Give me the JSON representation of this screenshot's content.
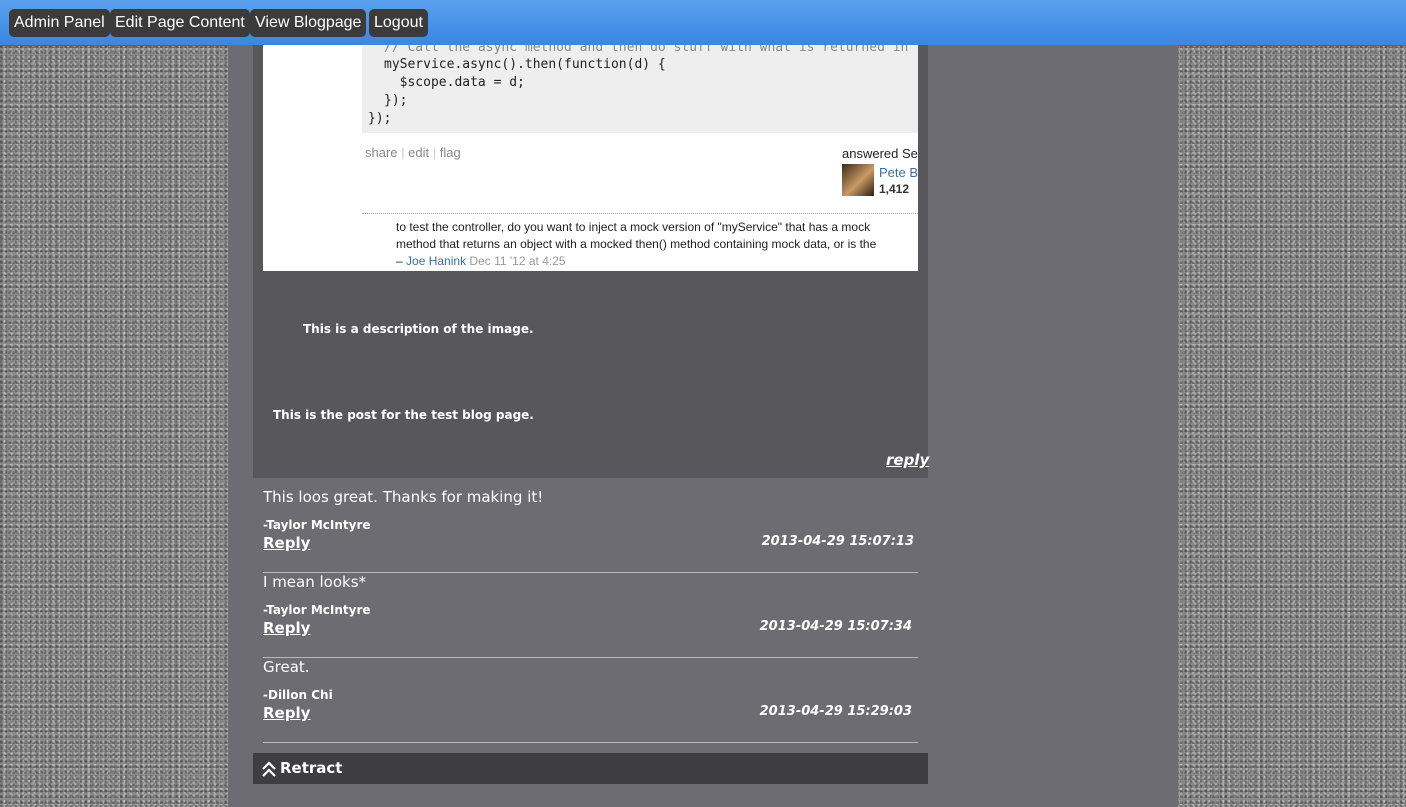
{
  "nav": {
    "admin_panel": "Admin Panel",
    "edit_page_content": "Edit Page Content",
    "view_blogpage": "View Blogpage",
    "logout": "Logout"
  },
  "post": {
    "image": {
      "code_lines": [
        "// Call the async method and then do stuff with what is returned in",
        "myService.async().then(function(d) {",
        "  $scope.data = d;",
        "});",
        "});"
      ],
      "actions": [
        "share",
        "edit",
        "flag"
      ],
      "answered": "answered Se",
      "user_name": "Pete B",
      "user_rep": "1,412",
      "comment_lines": [
        "to test the controller, do you want to inject a mock version of \"myService\" that has a mock",
        "method that returns an object with a mocked then() method containing mock data, or is the"
      ],
      "comment_dash": "–",
      "comment_author": "Joe Hanink",
      "comment_date": "Dec 11 '12 at 4:25"
    },
    "image_description": "This is a description of the image.",
    "text": "This is the post for the test blog page.",
    "reply_label": "reply"
  },
  "comments": [
    {
      "text": "This loos great. Thanks for making it!",
      "author": "-Taylor McIntyre",
      "reply": "Reply",
      "date": "2013-04-29 15:07:13"
    },
    {
      "text": "I mean looks*",
      "author": "-Taylor McIntyre",
      "reply": "Reply",
      "date": "2013-04-29 15:07:34"
    },
    {
      "text": "Great.",
      "author": "-Dillon Chi",
      "reply": "Reply",
      "date": "2013-04-29 15:29:03"
    }
  ],
  "retract": {
    "label": "Retract"
  },
  "colors": {
    "topbar": "#3a86e2",
    "button": "#3b3b3b",
    "column": "#6d6c72",
    "post_box": "#58585c",
    "retract_bar": "#3e3e40"
  }
}
